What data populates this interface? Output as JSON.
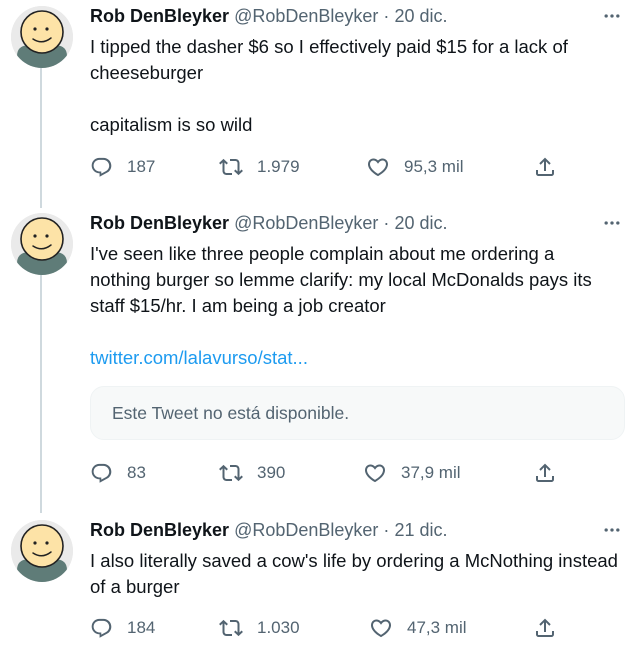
{
  "tweets": [
    {
      "name": "Rob DenBleyker",
      "handle": "@RobDenBleyker",
      "separator": "·",
      "date": "20 dic.",
      "text": "I tipped the dasher $6 so I effectively paid $15 for a lack of cheeseburger\n\ncapitalism is so wild",
      "replies": "187",
      "retweets": "1.979",
      "likes": "95,3 mil"
    },
    {
      "name": "Rob DenBleyker",
      "handle": "@RobDenBleyker",
      "separator": "·",
      "date": "20 dic.",
      "text": "I've seen like three people complain about me ordering a nothing burger so lemme clarify: my local McDonalds pays its staff $15/hr. I am being a job creator",
      "link": "twitter.com/lalavurso/stat...",
      "quote_unavailable": "Este Tweet no está disponible.",
      "replies": "83",
      "retweets": "390",
      "likes": "37,9 mil"
    },
    {
      "name": "Rob DenBleyker",
      "handle": "@RobDenBleyker",
      "separator": "·",
      "date": "21 dic.",
      "text": "I also literally saved a cow's life by ordering a McNothing instead of a burger",
      "replies": "184",
      "retweets": "1.030",
      "likes": "47,3 mil"
    }
  ],
  "icons": {
    "more": "more-horizontal-icon",
    "reply": "reply-icon",
    "retweet": "retweet-icon",
    "like": "heart-icon",
    "share": "share-icon"
  },
  "colors": {
    "text": "#0f1419",
    "secondary": "#536471",
    "link": "#1d9bf0",
    "thread_line": "#cfd9de",
    "avatar_shirt": "#5f7c78"
  }
}
